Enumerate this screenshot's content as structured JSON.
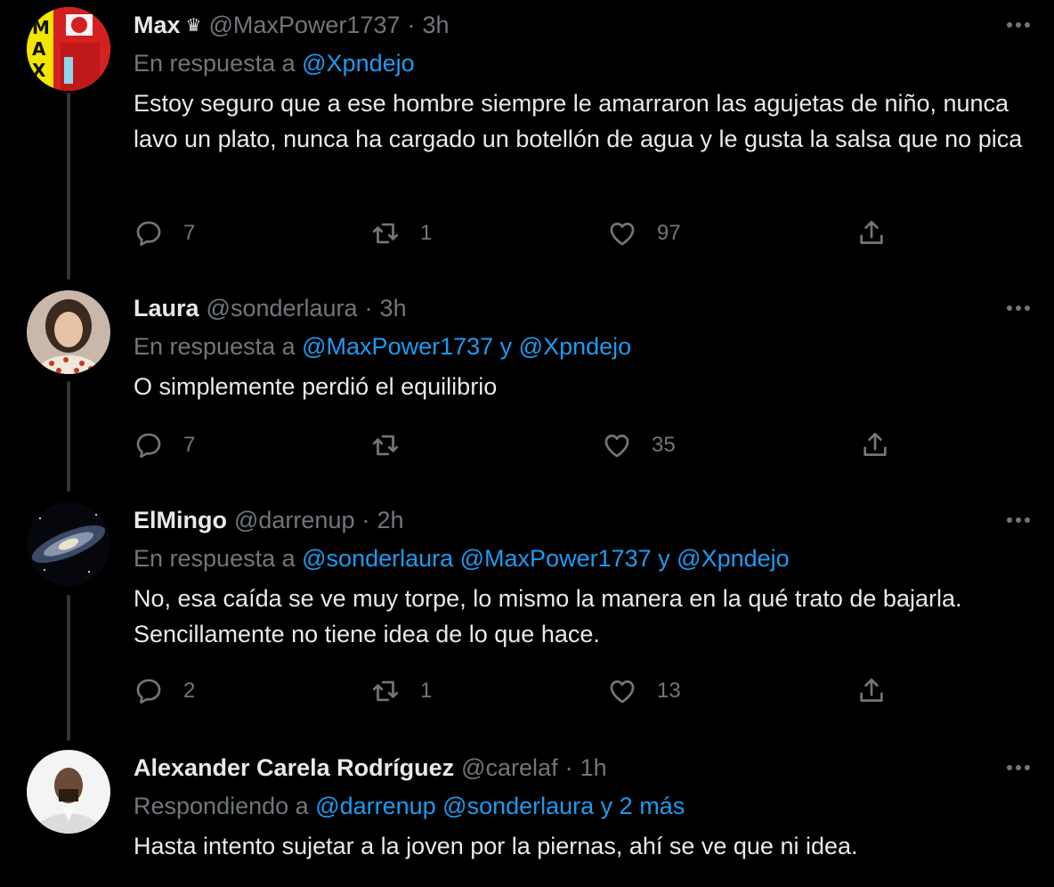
{
  "tweets": [
    {
      "name": "Max",
      "badge": "♛",
      "handle": "@MaxPower1737",
      "dot": "·",
      "time": "3h",
      "reply_prefix": "En respuesta a",
      "reply_links": "@Xpndejo",
      "text": "Estoy seguro que a ese hombre siempre le amarraron las agujetas de niño, nunca lavo un plato, nunca ha cargado un botellón de agua y le gusta la salsa que no pica",
      "replies": "7",
      "retweets": "1",
      "likes": "97",
      "avatar_text": "MAX",
      "avatar_icon": "avatar-max"
    },
    {
      "name": "Laura",
      "badge": "",
      "handle": "@sonderlaura",
      "dot": "·",
      "time": "3h",
      "reply_prefix": "En respuesta a",
      "reply_links": "@MaxPower1737 y @Xpndejo",
      "text": "O simplemente perdió el equilibrio",
      "replies": "7",
      "retweets": "",
      "likes": "35",
      "avatar_icon": "avatar-laura"
    },
    {
      "name": "ElMingo",
      "badge": "",
      "handle": "@darrenup",
      "dot": "·",
      "time": "2h",
      "reply_prefix": "En respuesta a",
      "reply_links": "@sonderlaura @MaxPower1737 y @Xpndejo",
      "text": "No, esa caída se ve muy torpe, lo mismo la manera en la qué trato de bajarla. Sencillamente no tiene idea de lo que hace.",
      "replies": "2",
      "retweets": "1",
      "likes": "13",
      "avatar_icon": "avatar-galaxy"
    },
    {
      "name": "Alexander Carela Rodríguez",
      "badge": "",
      "handle": "@carelaf",
      "dot": "·",
      "time": "1h",
      "reply_prefix": "Respondiendo a",
      "reply_links": "@darrenup @sonderlaura y 2 más",
      "text": "Hasta intento sujetar a la joven por la piernas, ahí se ve que ni idea.",
      "avatar_icon": "avatar-alexander"
    }
  ],
  "icons": {
    "reply": "comment-icon",
    "retweet": "retweet-icon",
    "like": "heart-icon",
    "share": "share-icon",
    "more": "more-icon"
  },
  "colors": {
    "background": "#000000",
    "text": "#e7e9ea",
    "secondary": "#71767b",
    "link": "#1d9bf0",
    "thread_line": "#333639"
  }
}
